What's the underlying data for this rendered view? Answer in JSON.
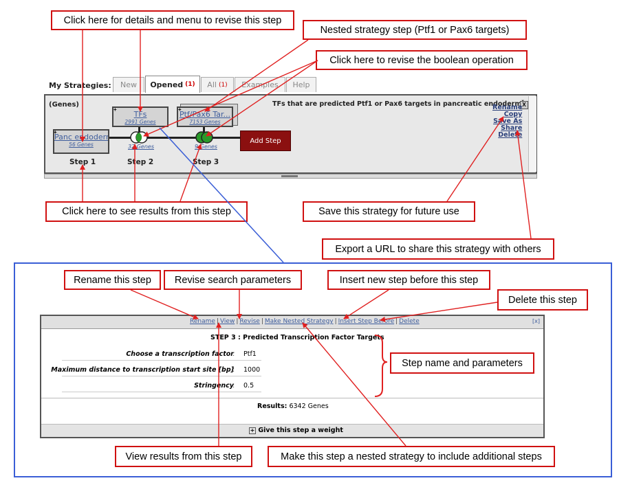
{
  "callouts": {
    "details_menu": "Click here for details and menu to revise this step",
    "nested_step": "Nested strategy step (Ptf1 or Pax6 targets)",
    "boolean_op": "Click here to revise the boolean operation",
    "see_results": "Click here to see results from this step",
    "save_strategy": "Save this strategy for future use",
    "export_url": "Export a URL to share this strategy with others",
    "rename_step": "Rename this step",
    "revise_params": "Revise search parameters",
    "insert_before": "Insert new step before this step",
    "delete_step": "Delete this step",
    "step_name_params": "Step name and parameters",
    "view_results": "View results from this step",
    "make_nested": "Make this step a nested strategy to include additional steps"
  },
  "tabs": {
    "my_strategies": "My Strategies:",
    "items": [
      {
        "label": "New",
        "count": ""
      },
      {
        "label": "Opened",
        "count": "(1)"
      },
      {
        "label": "All",
        "count": "(1)"
      },
      {
        "label": "Examples",
        "count": ""
      },
      {
        "label": "Help",
        "count": ""
      }
    ]
  },
  "strategy": {
    "record_type": "(Genes)",
    "title": "TFs that are predicted Ptf1 or Pax6 targets in pancreatic endoderm",
    "title_mark": "*",
    "close_glyph": "X",
    "steps": [
      {
        "name": "Panc endoderm",
        "count": "56 Genes",
        "label": "Step 1"
      },
      {
        "name": "TFs",
        "count": "2991 Genes",
        "result": "32 Genes",
        "label": "Step 2"
      },
      {
        "name": "Ptf/Pax6 Tar...",
        "count": "7153 Genes",
        "result": "9 Genes",
        "label": "Step 3"
      }
    ],
    "add_step": "Add Step",
    "actions": [
      "Rename",
      "Copy",
      "Save As",
      "Share",
      "Delete"
    ]
  },
  "detail": {
    "links": [
      "Rename",
      "View",
      "Revise",
      "Make Nested Strategy",
      "Insert Step Before",
      "Delete"
    ],
    "close_glyph": "[x]",
    "title": "STEP 3 : Predicted Transcription Factor Targets",
    "params": [
      {
        "label": "Choose a transcription factor",
        "value": "Ptf1"
      },
      {
        "label": "Maximum distance to transcription start site [bp]",
        "value": "1000"
      },
      {
        "label": "Stringency",
        "value": "0.5"
      }
    ],
    "results_label": "Results:",
    "results_value": "6342 Genes",
    "weight_label": "Give this step a weight",
    "weight_icon": "+"
  },
  "colors": {
    "callout_border": "#d01010",
    "arrow": "#e02020",
    "frame": "#3a5ed6",
    "add_step": "#8b1010"
  }
}
